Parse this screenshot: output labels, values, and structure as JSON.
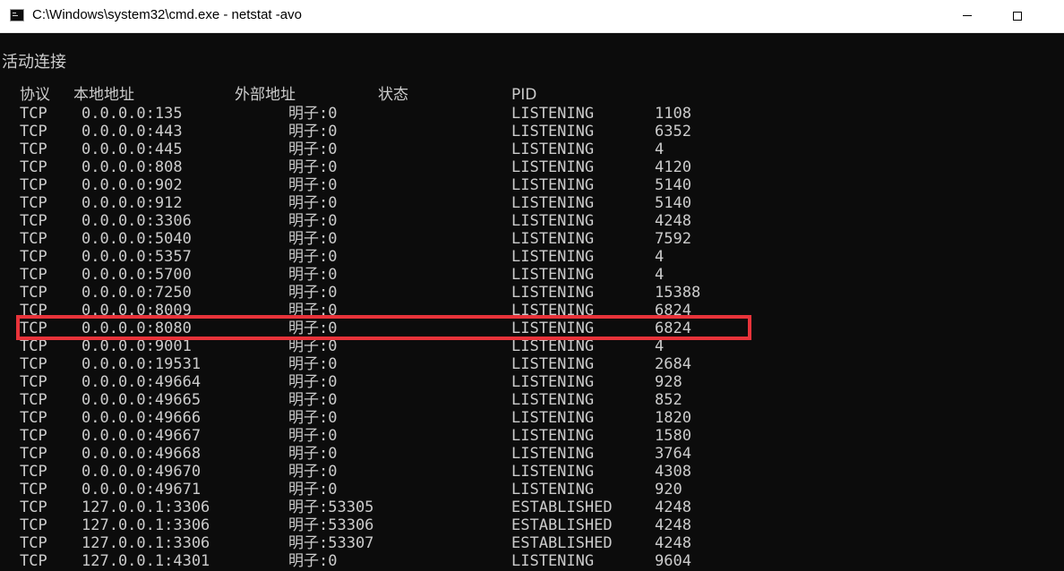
{
  "window": {
    "title": "C:\\Windows\\system32\\cmd.exe - netstat  -avo",
    "icon": "console-icon"
  },
  "console": {
    "section_title": "活动连接",
    "headers": {
      "proto": "协议",
      "local": "本地地址",
      "foreign": "外部地址",
      "state": "状态",
      "pid": "PID"
    },
    "rows": [
      {
        "proto": "TCP",
        "local": "0.0.0.0:135",
        "foreign": "明子:0",
        "state": "LISTENING",
        "pid": "1108"
      },
      {
        "proto": "TCP",
        "local": "0.0.0.0:443",
        "foreign": "明子:0",
        "state": "LISTENING",
        "pid": "6352"
      },
      {
        "proto": "TCP",
        "local": "0.0.0.0:445",
        "foreign": "明子:0",
        "state": "LISTENING",
        "pid": "4"
      },
      {
        "proto": "TCP",
        "local": "0.0.0.0:808",
        "foreign": "明子:0",
        "state": "LISTENING",
        "pid": "4120"
      },
      {
        "proto": "TCP",
        "local": "0.0.0.0:902",
        "foreign": "明子:0",
        "state": "LISTENING",
        "pid": "5140"
      },
      {
        "proto": "TCP",
        "local": "0.0.0.0:912",
        "foreign": "明子:0",
        "state": "LISTENING",
        "pid": "5140"
      },
      {
        "proto": "TCP",
        "local": "0.0.0.0:3306",
        "foreign": "明子:0",
        "state": "LISTENING",
        "pid": "4248"
      },
      {
        "proto": "TCP",
        "local": "0.0.0.0:5040",
        "foreign": "明子:0",
        "state": "LISTENING",
        "pid": "7592"
      },
      {
        "proto": "TCP",
        "local": "0.0.0.0:5357",
        "foreign": "明子:0",
        "state": "LISTENING",
        "pid": "4"
      },
      {
        "proto": "TCP",
        "local": "0.0.0.0:5700",
        "foreign": "明子:0",
        "state": "LISTENING",
        "pid": "4"
      },
      {
        "proto": "TCP",
        "local": "0.0.0.0:7250",
        "foreign": "明子:0",
        "state": "LISTENING",
        "pid": "15388"
      },
      {
        "proto": "TCP",
        "local": "0.0.0.0:8009",
        "foreign": "明子:0",
        "state": "LISTENING",
        "pid": "6824"
      },
      {
        "proto": "TCP",
        "local": "0.0.0.0:8080",
        "foreign": "明子:0",
        "state": "LISTENING",
        "pid": "6824"
      },
      {
        "proto": "TCP",
        "local": "0.0.0.0:9001",
        "foreign": "明子:0",
        "state": "LISTENING",
        "pid": "4"
      },
      {
        "proto": "TCP",
        "local": "0.0.0.0:19531",
        "foreign": "明子:0",
        "state": "LISTENING",
        "pid": "2684"
      },
      {
        "proto": "TCP",
        "local": "0.0.0.0:49664",
        "foreign": "明子:0",
        "state": "LISTENING",
        "pid": "928"
      },
      {
        "proto": "TCP",
        "local": "0.0.0.0:49665",
        "foreign": "明子:0",
        "state": "LISTENING",
        "pid": "852"
      },
      {
        "proto": "TCP",
        "local": "0.0.0.0:49666",
        "foreign": "明子:0",
        "state": "LISTENING",
        "pid": "1820"
      },
      {
        "proto": "TCP",
        "local": "0.0.0.0:49667",
        "foreign": "明子:0",
        "state": "LISTENING",
        "pid": "1580"
      },
      {
        "proto": "TCP",
        "local": "0.0.0.0:49668",
        "foreign": "明子:0",
        "state": "LISTENING",
        "pid": "3764"
      },
      {
        "proto": "TCP",
        "local": "0.0.0.0:49670",
        "foreign": "明子:0",
        "state": "LISTENING",
        "pid": "4308"
      },
      {
        "proto": "TCP",
        "local": "0.0.0.0:49671",
        "foreign": "明子:0",
        "state": "LISTENING",
        "pid": "920"
      },
      {
        "proto": "TCP",
        "local": "127.0.0.1:3306",
        "foreign": "明子:53305",
        "state": "ESTABLISHED",
        "pid": "4248"
      },
      {
        "proto": "TCP",
        "local": "127.0.0.1:3306",
        "foreign": "明子:53306",
        "state": "ESTABLISHED",
        "pid": "4248"
      },
      {
        "proto": "TCP",
        "local": "127.0.0.1:3306",
        "foreign": "明子:53307",
        "state": "ESTABLISHED",
        "pid": "4248"
      },
      {
        "proto": "TCP",
        "local": "127.0.0.1:4301",
        "foreign": "明子:0",
        "state": "LISTENING",
        "pid": "9604"
      }
    ],
    "highlighted_row": 12,
    "highlight_color": "#e8333a",
    "text_color": "#cccccc",
    "background_color": "#0c0c0c"
  }
}
